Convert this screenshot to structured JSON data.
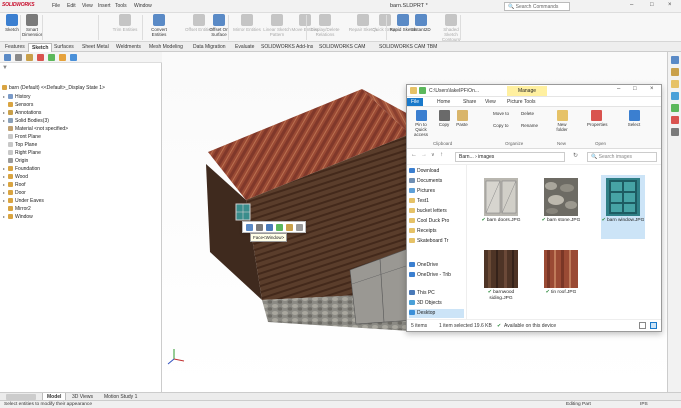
{
  "app": {
    "logo": "SOLIDWORKS",
    "menu": [
      "File",
      "Edit",
      "View",
      "Insert",
      "Tools",
      "Window"
    ],
    "file_title": "barn.SLDPRT *",
    "search_placeholder": "Search Commands"
  },
  "ribbon": [
    {
      "label": "Sketch",
      "color": "#3b7fd0",
      "enabled": true
    },
    {
      "label": "Smart Dimension",
      "color": "#7a7a7a",
      "enabled": true
    },
    {
      "label": "Trim Entities",
      "color": "#7a7a7a",
      "enabled": false
    },
    {
      "label": "Convert Entities",
      "color": "#5a8ac6",
      "enabled": true
    },
    {
      "label": "Offset Entities",
      "color": "#7a7a7a",
      "enabled": false
    },
    {
      "label": "Offset On Surface",
      "color": "#5a8ac6",
      "enabled": true
    },
    {
      "label": "Mirror Entities",
      "color": "#7a7a7a",
      "enabled": false
    },
    {
      "label": "Linear Sketch Pattern",
      "color": "#7a7a7a",
      "enabled": false
    },
    {
      "label": "Move Entities",
      "color": "#7a7a7a",
      "enabled": false
    },
    {
      "label": "Display/Delete Relations",
      "color": "#7a7a7a",
      "enabled": false
    },
    {
      "label": "Repair Sketch",
      "color": "#7a7a7a",
      "enabled": false
    },
    {
      "label": "Quick Snaps",
      "color": "#7a7a7a",
      "enabled": false
    },
    {
      "label": "Rapid Sketch",
      "color": "#5a8ac6",
      "enabled": true
    },
    {
      "label": "Instant2D",
      "color": "#5a8ac6",
      "enabled": true
    },
    {
      "label": "Shaded Sketch Contours",
      "color": "#7a7a7a",
      "enabled": false
    }
  ],
  "tabs": [
    "Features",
    "Sketch",
    "Surfaces",
    "Sheet Metal",
    "Weldments",
    "Mesh Modeling",
    "Data Migration",
    "Evaluate",
    "SOLIDWORKS Add-Ins",
    "SOLIDWORKS CAM",
    "SOLIDWORKS CAM TBM"
  ],
  "active_tab": "Sketch",
  "tree": {
    "root": "barn (Default) <<Default>_Display State 1>",
    "items": [
      {
        "label": "History",
        "icon": "history-icon",
        "expand": true
      },
      {
        "label": "Sensors",
        "icon": "sensors-icon",
        "expand": false
      },
      {
        "label": "Annotations",
        "icon": "annotations-icon",
        "expand": true
      },
      {
        "label": "Solid Bodies(3)",
        "icon": "solid-bodies-icon",
        "expand": true
      },
      {
        "label": "Material <not specified>",
        "icon": "material-icon",
        "expand": false
      },
      {
        "label": "Front Plane",
        "icon": "plane-icon",
        "expand": false
      },
      {
        "label": "Top Plane",
        "icon": "plane-icon",
        "expand": false
      },
      {
        "label": "Right Plane",
        "icon": "plane-icon",
        "expand": false
      },
      {
        "label": "Origin",
        "icon": "origin-icon",
        "expand": false
      },
      {
        "label": "Foundation",
        "icon": "feature-icon",
        "expand": true
      },
      {
        "label": "Wood",
        "icon": "feature-icon",
        "expand": true
      },
      {
        "label": "Roof",
        "icon": "feature-icon",
        "expand": true
      },
      {
        "label": "Door",
        "icon": "feature-icon",
        "expand": true
      },
      {
        "label": "Under Eaves",
        "icon": "feature-icon",
        "expand": true
      },
      {
        "label": "Mirror2",
        "icon": "mirror-icon",
        "expand": false
      },
      {
        "label": "Window",
        "icon": "feature-icon",
        "expand": true
      }
    ]
  },
  "context_tooltip": "Face<Window>",
  "explorer": {
    "path": "C:\\Users\\lakeIPF\\On...",
    "manage_tab": "Manage",
    "tabs": [
      "File",
      "Home",
      "Share",
      "View",
      "Picture Tools"
    ],
    "ribbon_buttons": [
      {
        "label": "Pin to Quick access",
        "color": "#3b7fd0"
      },
      {
        "label": "Copy",
        "color": "#6a6a6a"
      },
      {
        "label": "Paste",
        "color": "#d9b56a"
      },
      {
        "label": "New folder",
        "color": "#e6c267"
      },
      {
        "label": "Properties",
        "color": "#d9534f"
      },
      {
        "label": "Select",
        "color": "#3b7fd0"
      }
    ],
    "small_buttons": [
      "Move to",
      "Copy to",
      "Delete",
      "Rename"
    ],
    "groups": [
      "Clipboard",
      "Organize",
      "New",
      "Open"
    ],
    "crumbs": "Barn... › images",
    "search_placeholder": "Search images",
    "nav": [
      {
        "label": "Download",
        "color": "#3b7fd0",
        "selected": false
      },
      {
        "label": "Documents",
        "color": "#6f8fb4",
        "selected": false
      },
      {
        "label": "Pictures",
        "color": "#5ea0d8",
        "selected": false
      },
      {
        "label": "Test1",
        "color": "#e6c267",
        "selected": false
      },
      {
        "label": "bucket letters",
        "color": "#e6c267",
        "selected": false
      },
      {
        "label": "Cool Duck Pro",
        "color": "#e6c267",
        "selected": false
      },
      {
        "label": "Receipts",
        "color": "#e6c267",
        "selected": false
      },
      {
        "label": "Skateboard Tr",
        "color": "#e6c267",
        "selected": false
      },
      {
        "label": "OneDrive",
        "color": "#3b7fd0",
        "selected": false
      },
      {
        "label": "OneDrive - Trib",
        "color": "#3b7fd0",
        "selected": false
      },
      {
        "label": "This PC",
        "color": "#4a7ab8",
        "selected": false
      },
      {
        "label": "3D Objects",
        "color": "#4aa0d8",
        "selected": false
      },
      {
        "label": "Desktop",
        "color": "#3b8fd8",
        "selected": true
      }
    ],
    "files": [
      {
        "name": "barn doors.JPG",
        "thumb": "doors",
        "selected": false
      },
      {
        "name": "barn stone.JPG",
        "thumb": "stone",
        "selected": false
      },
      {
        "name": "barn window.JPG",
        "thumb": "window",
        "selected": true
      },
      {
        "name": "barnwood siding.JPG",
        "thumb": "siding",
        "selected": false
      },
      {
        "name": "tin roof.JPG",
        "thumb": "roof",
        "selected": false
      }
    ],
    "status_count": "5 items",
    "status_selected": "1 item selected  19.6 KB",
    "status_available": "Available on this device"
  },
  "bottom_tabs": [
    "Model",
    "3D Views",
    "Motion Study 1"
  ],
  "status_left": "Select entities to modify their appearance",
  "status_mode": "Editing Part",
  "status_units": "IPS"
}
